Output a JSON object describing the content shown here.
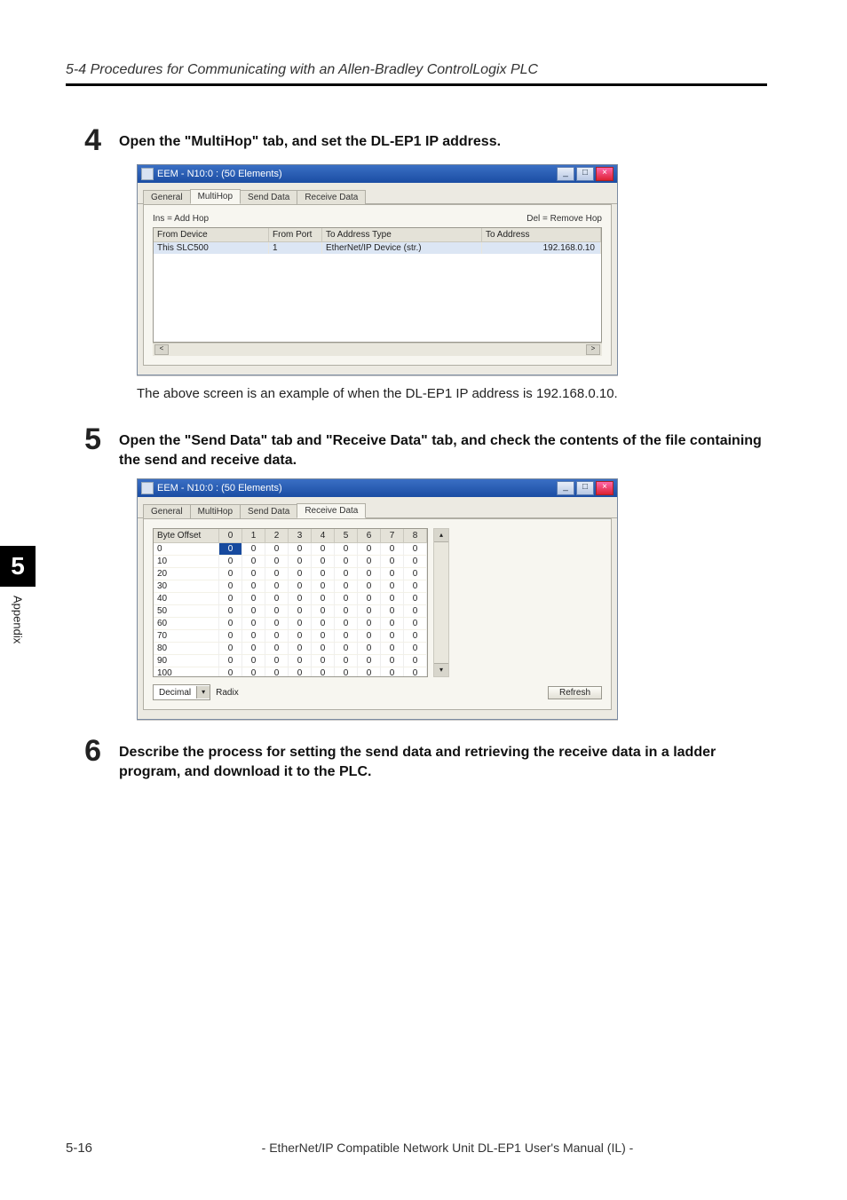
{
  "header": {
    "section_title": "5-4 Procedures for Communicating with an Allen-Bradley ControlLogix PLC"
  },
  "side_tab": {
    "number": "5",
    "label": "Appendix"
  },
  "steps": {
    "s4": {
      "num": "4",
      "text": "Open the \"MultiHop\" tab, and set the DL-EP1 IP address."
    },
    "s4_caption": "The above screen is an example of when the DL-EP1 IP address is 192.168.0.10.",
    "s5": {
      "num": "5",
      "text": "Open the \"Send Data\" tab and \"Receive Data\" tab, and check the contents of the file containing the send and receive data."
    },
    "s6": {
      "num": "6",
      "text": "Describe the process for setting the send data and retrieving the receive data in a ladder program, and download it to the PLC."
    }
  },
  "win_common": {
    "title": "EEM - N10:0 : (50 Elements)",
    "min_glyph": "_",
    "max_glyph": "□",
    "close_glyph": "×",
    "tabs": {
      "general": "General",
      "multihop": "MultiHop",
      "send": "Send Data",
      "receive": "Receive Data"
    }
  },
  "multihop": {
    "legend_left": "Ins = Add Hop",
    "legend_right": "Del = Remove Hop",
    "headers": {
      "from_device": "From Device",
      "from_port": "From Port",
      "to_addr_type": "To Address Type",
      "to_addr": "To Address"
    },
    "row": {
      "from_device": "This SLC500",
      "from_port": "1",
      "to_addr_type": "EtherNet/IP Device (str.)",
      "to_addr": "192.168.0.10"
    },
    "scroll_left": "<",
    "scroll_right": ">"
  },
  "receive": {
    "col_label": "Byte Offset",
    "cols": [
      "0",
      "1",
      "2",
      "3",
      "4",
      "5",
      "6",
      "7",
      "8"
    ],
    "row_offsets": [
      "0",
      "10",
      "20",
      "30",
      "40",
      "50",
      "60",
      "70",
      "80",
      "90",
      "100"
    ],
    "cell_value": "0",
    "scroll_up": "▴",
    "scroll_down": "▾",
    "radix_value": "Decimal",
    "radix_label": "Radix",
    "combo_arrow": "▾",
    "refresh": "Refresh"
  },
  "footer": {
    "page": "5-16",
    "title": "- EtherNet/IP Compatible Network Unit DL-EP1 User's Manual (IL) -"
  }
}
